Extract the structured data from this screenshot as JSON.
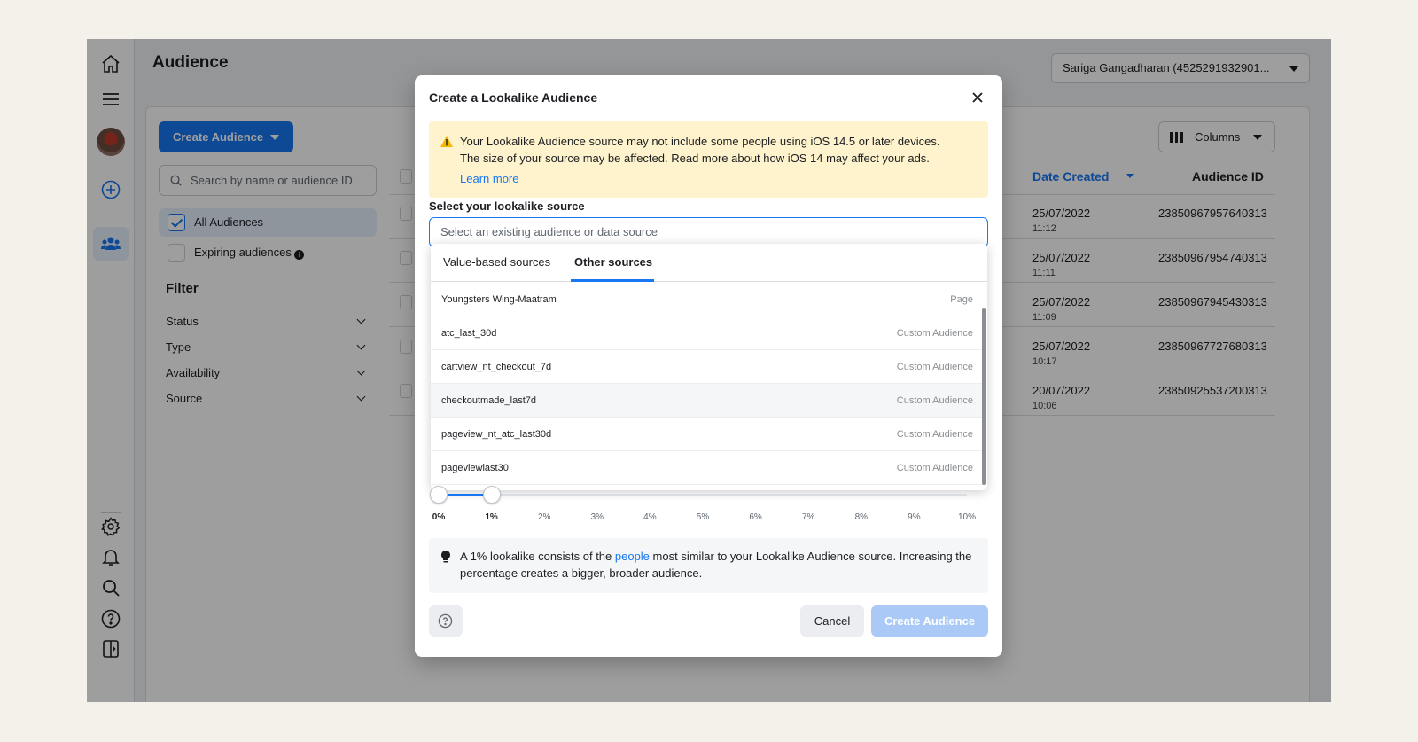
{
  "page": {
    "title": "Audience",
    "account": "Sariga Gangadharan (4525291932901..."
  },
  "toolbar": {
    "create_label": "Create Audience",
    "search_placeholder": "Search by name or audience ID",
    "columns_label": "Columns"
  },
  "sidebar": {
    "all_audiences": "All Audiences",
    "expiring_audiences": "Expiring audiences",
    "filter_title": "Filter",
    "filters": [
      "Status",
      "Type",
      "Availability",
      "Source"
    ]
  },
  "table": {
    "headers": {
      "date": "Date Created",
      "id": "Audience ID"
    },
    "rows": [
      {
        "date": "25/07/2022",
        "time": "11:12",
        "id": "23850967957640313"
      },
      {
        "date": "25/07/2022",
        "time": "11:11",
        "id": "23850967954740313"
      },
      {
        "date": "25/07/2022",
        "time": "11:09",
        "id": "23850967945430313"
      },
      {
        "date": "25/07/2022",
        "time": "10:17",
        "id": "23850967727680313"
      },
      {
        "date": "20/07/2022",
        "time": "10:06",
        "id": "23850925537200313"
      }
    ]
  },
  "modal": {
    "title": "Create a Lookalike Audience",
    "warning_line1": "Your Lookalike Audience source may not include some people using iOS 14.5 or later devices.",
    "warning_line2": "The size of your source may be affected. Read more about how iOS 14 may affect your ads.",
    "warning_link": "Learn more",
    "source_label": "Select your lookalike source",
    "source_placeholder": "Select an existing audience or data source",
    "tabs": [
      "Value-based sources",
      "Other sources"
    ],
    "active_tab": "Other sources",
    "sources": [
      {
        "name": "Youngsters Wing-Maatram",
        "type": "Page"
      },
      {
        "name": "atc_last_30d",
        "type": "Custom Audience"
      },
      {
        "name": "cartview_nt_checkout_7d",
        "type": "Custom Audience"
      },
      {
        "name": "checkoutmade_last7d",
        "type": "Custom Audience"
      },
      {
        "name": "pageview_nt_atc_last30d",
        "type": "Custom Audience"
      },
      {
        "name": "pageviewlast30",
        "type": "Custom Audience"
      }
    ],
    "slider": {
      "ticks": [
        "0%",
        "1%",
        "2%",
        "3%",
        "4%",
        "5%",
        "6%",
        "7%",
        "8%",
        "9%",
        "10%"
      ],
      "range_start_percent": 0,
      "range_end_percent": 1
    },
    "tip_part1": "A 1% lookalike consists of the ",
    "tip_link": "people",
    "tip_part2": " most similar to your Lookalike Audience source. Increasing the percentage creates a bigger, broader audience.",
    "cancel_label": "Cancel",
    "create_label": "Create Audience"
  },
  "colors": {
    "accent": "#1877f2",
    "warning_bg": "#fff3cd",
    "disabled_primary": "#aac9f7"
  }
}
